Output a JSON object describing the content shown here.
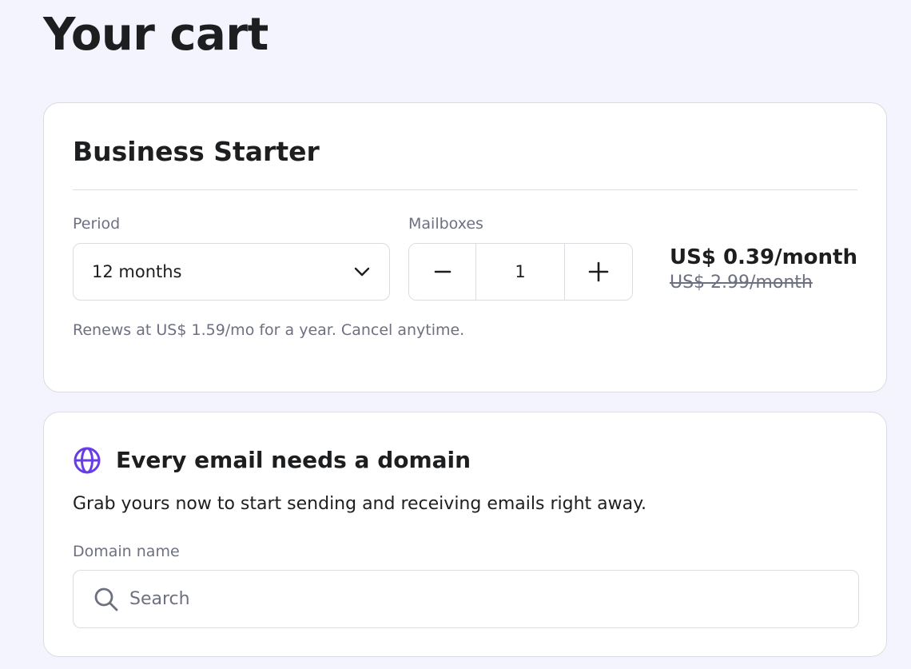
{
  "page": {
    "title": "Your cart"
  },
  "plan": {
    "name": "Business Starter",
    "period_label": "Period",
    "period_value": "12 months",
    "mailboxes_label": "Mailboxes",
    "mailboxes_value": "1",
    "price_now": "US$ 0.39/month",
    "price_old": "US$ 2.99/month",
    "renew_note": "Renews at US$ 1.59/mo for a year. Cancel anytime."
  },
  "domain": {
    "title": "Every email needs a domain",
    "subtitle": "Grab yours now to start sending and receiving emails right away.",
    "label": "Domain name",
    "placeholder": "Search"
  },
  "icons": {
    "globe": "globe-icon",
    "search": "search-icon",
    "chevron": "chevron-down-icon",
    "minus": "minus-icon",
    "plus": "plus-icon"
  },
  "colors": {
    "background": "#f4f4ff",
    "accent": "#673de6",
    "text": "#1d1e20",
    "muted": "#6d7081",
    "border": "#dadce0"
  }
}
